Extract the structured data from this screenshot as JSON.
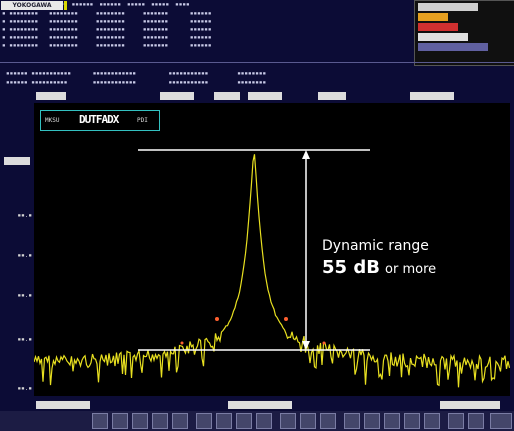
{
  "brand": "YOKOGAWA",
  "marker_box": {
    "big": "DUTFADX",
    "small1": "MKSU",
    "small2": "PDI"
  },
  "annotation": {
    "line1": "Dynamic range",
    "line2_value": "55 dB",
    "line2_suffix": "or more"
  },
  "colors": {
    "background": "#0c0c36",
    "plot_bg": "#000000",
    "trace": "#e8e020",
    "box_border": "#33c0c0",
    "annotation": "#ffffff"
  },
  "trace_shape": {
    "peak_rel_x": 0.5,
    "peak_level": 1.0,
    "noise_level": 0.12,
    "dynamic_range_db": 55
  }
}
